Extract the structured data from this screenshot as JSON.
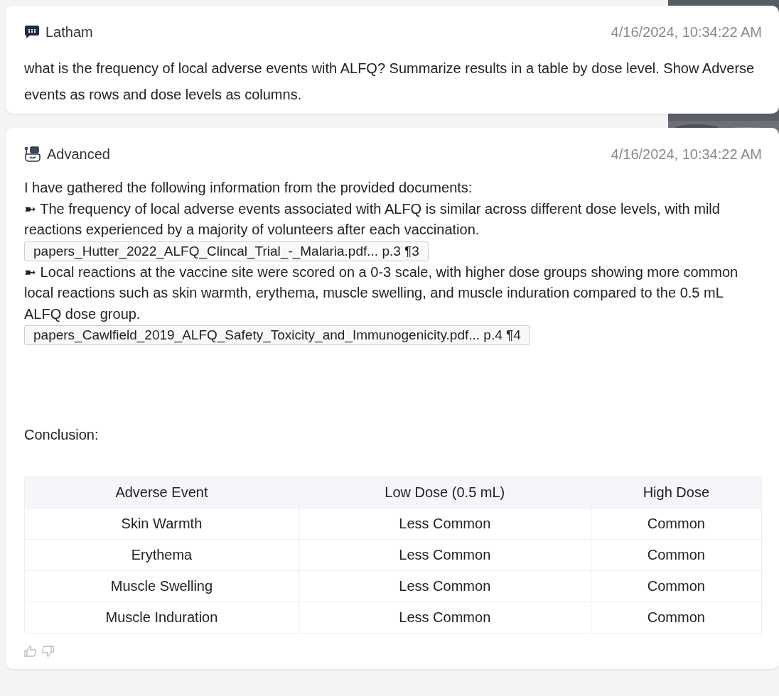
{
  "messages": [
    {
      "kind": "user",
      "author": "Latham",
      "time": "4/16/2024, 10:34:22 AM",
      "blocks": [
        {
          "kind": "paragraph",
          "text": "what is the frequency of local adverse events with ALFQ? Summarize results in a table by dose level. Show Adverse events as rows and dose levels as columns."
        }
      ]
    },
    {
      "kind": "assistant",
      "author": "Advanced",
      "time": "4/16/2024, 10:34:22 AM",
      "blocks": [
        {
          "kind": "paragraph",
          "text": "I have gathered the following information from the provided documents:"
        },
        {
          "kind": "bullet",
          "marker": "➼",
          "text": "The frequency of local adverse events associated with ALFQ is similar across different dose levels, with mild reactions experienced by a majority of volunteers after each vaccination."
        },
        {
          "kind": "citation",
          "text": "papers_Hutter_2022_ALFQ_Clincal_Trial_-_Malaria.pdf... p.3 ¶3"
        },
        {
          "kind": "bullet",
          "marker": "➼",
          "text": "Local reactions at the vaccine site were scored on a 0-3 scale, with higher dose groups showing more common local reactions such as skin warmth, erythema, muscle swelling, and muscle induration compared to the 0.5 mL ALFQ dose group."
        },
        {
          "kind": "citation",
          "text": "papers_Cawlfield_2019_ALFQ_Safety_Toxicity_and_Immunogenicity.pdf... p.4 ¶4"
        },
        {
          "kind": "heading",
          "text": "Conclusion:"
        },
        {
          "kind": "table",
          "columns": [
            "Adverse Event",
            "Low Dose (0.5 mL)",
            "High Dose"
          ],
          "rows": [
            [
              "Skin Warmth",
              "Less Common",
              "Common"
            ],
            [
              "Erythema",
              "Less Common",
              "Common"
            ],
            [
              "Muscle Swelling",
              "Less Common",
              "Common"
            ],
            [
              "Muscle Induration",
              "Less Common",
              "Common"
            ]
          ]
        }
      ],
      "feedback": true
    }
  ]
}
